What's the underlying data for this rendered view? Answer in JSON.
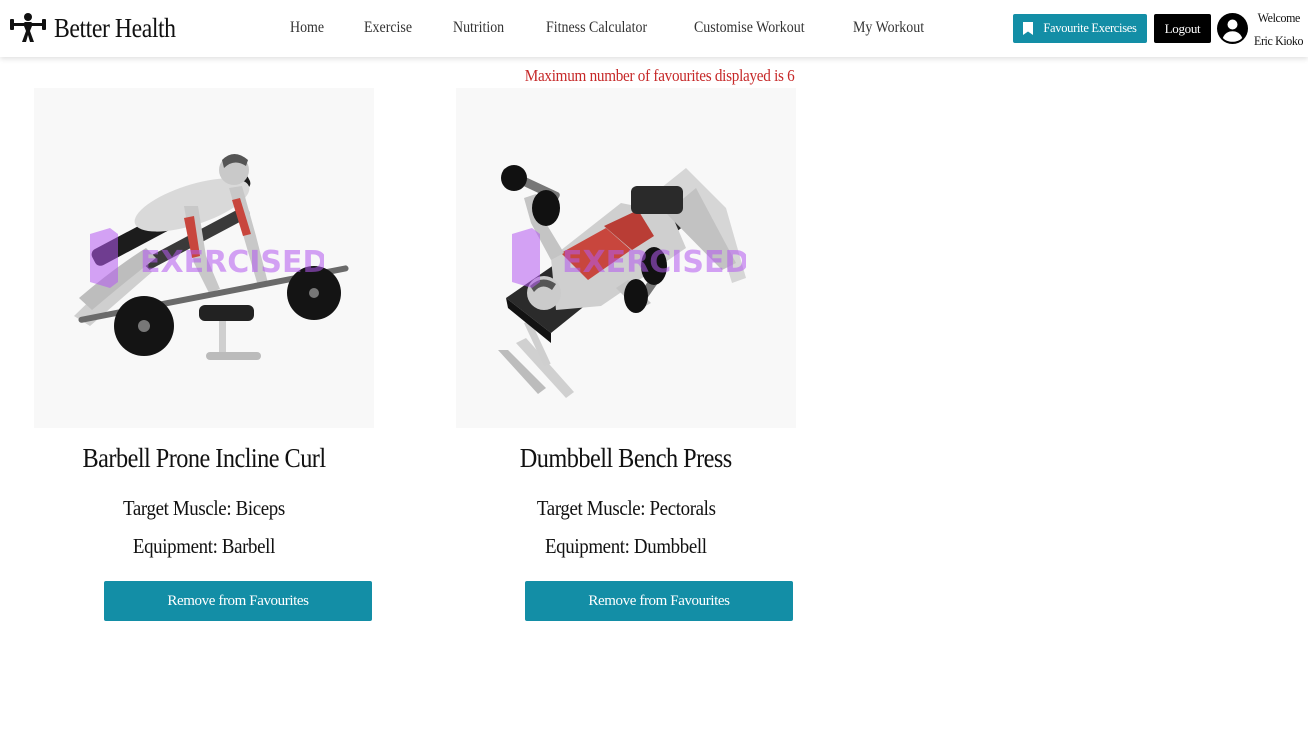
{
  "header": {
    "brand": "Better Health",
    "nav": [
      "Home",
      "Exercise",
      "Nutrition",
      "Fitness Calculator",
      "Customise Workout",
      "My Workout"
    ],
    "favourites_button": "Favourite Exercises",
    "logout_button": "Logout",
    "welcome": "Welcome",
    "user_name": "Eric Kioko"
  },
  "main": {
    "notice": "Maximum number of favourites displayed is 6",
    "cards": [
      {
        "image_icon": "barbell-prone-incline-curl-illustration",
        "watermark": "EXERCISEDB",
        "title": "Barbell Prone Incline Curl",
        "target_muscle": "Target Muscle: Biceps",
        "equipment": "Equipment: Barbell",
        "button": "Remove from Favourites"
      },
      {
        "image_icon": "dumbbell-bench-press-illustration",
        "watermark": "EXERCISEDB",
        "title": "Dumbbell Bench Press",
        "target_muscle": "Target Muscle: Pectorals",
        "equipment": "Equipment: Dumbbell",
        "button": "Remove from Favourites"
      }
    ]
  },
  "colors": {
    "accent": "#138ea6",
    "notice": "#c62828",
    "logout": "#000000",
    "muscle_highlight": "#c8463d",
    "watermark": "#b45af0"
  }
}
